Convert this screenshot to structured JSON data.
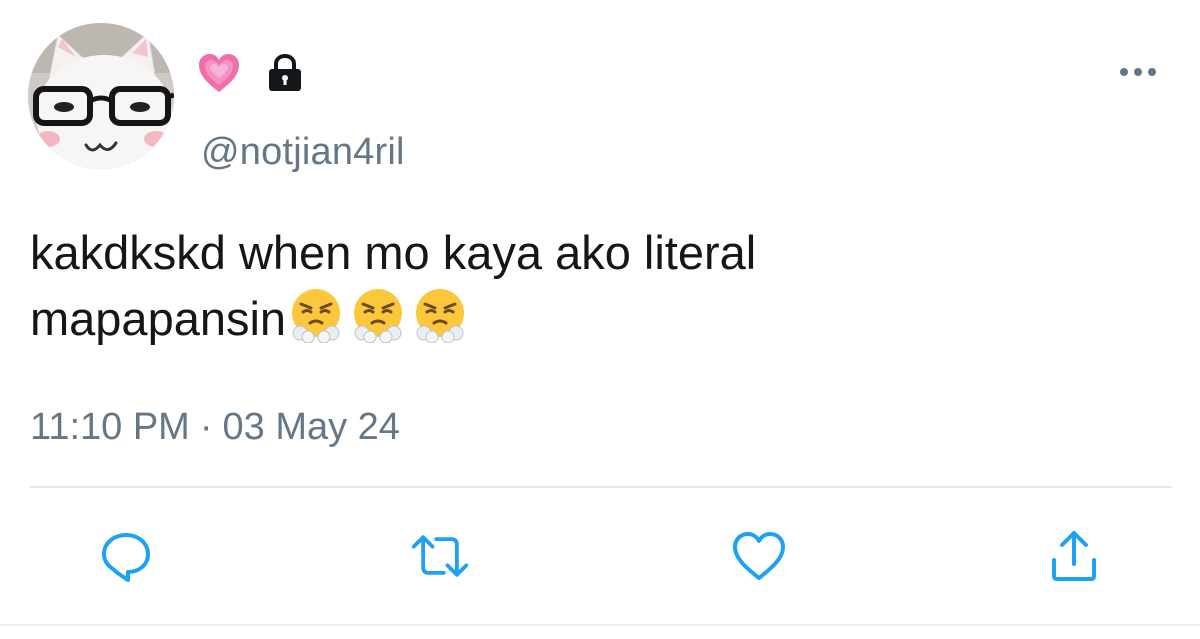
{
  "user": {
    "avatar_icon": "plush-cat-with-glasses-avatar",
    "badge_icons": [
      "growing-heart-icon",
      "lock-icon"
    ],
    "handle": "@notjian4ril"
  },
  "more_icon": "more-horizontal-icon",
  "tweet": {
    "text_line_1": "kakdkskd when mo kaya ako literal",
    "text_line_2": "mapapansin",
    "emojis": [
      "face-with-steam-from-nose",
      "face-with-steam-from-nose",
      "face-with-steam-from-nose"
    ]
  },
  "meta": {
    "time": "11:10 PM",
    "separator": "·",
    "date": "03 May 24"
  },
  "actions": [
    {
      "name": "reply",
      "icon": "reply-icon"
    },
    {
      "name": "retweet",
      "icon": "retweet-icon"
    },
    {
      "name": "like",
      "icon": "heart-outline-icon"
    },
    {
      "name": "share",
      "icon": "share-icon"
    }
  ],
  "colors": {
    "text": "#14171a",
    "secondary": "#657786",
    "icon": "#1da1f2",
    "divider": "#e1e8ed"
  }
}
